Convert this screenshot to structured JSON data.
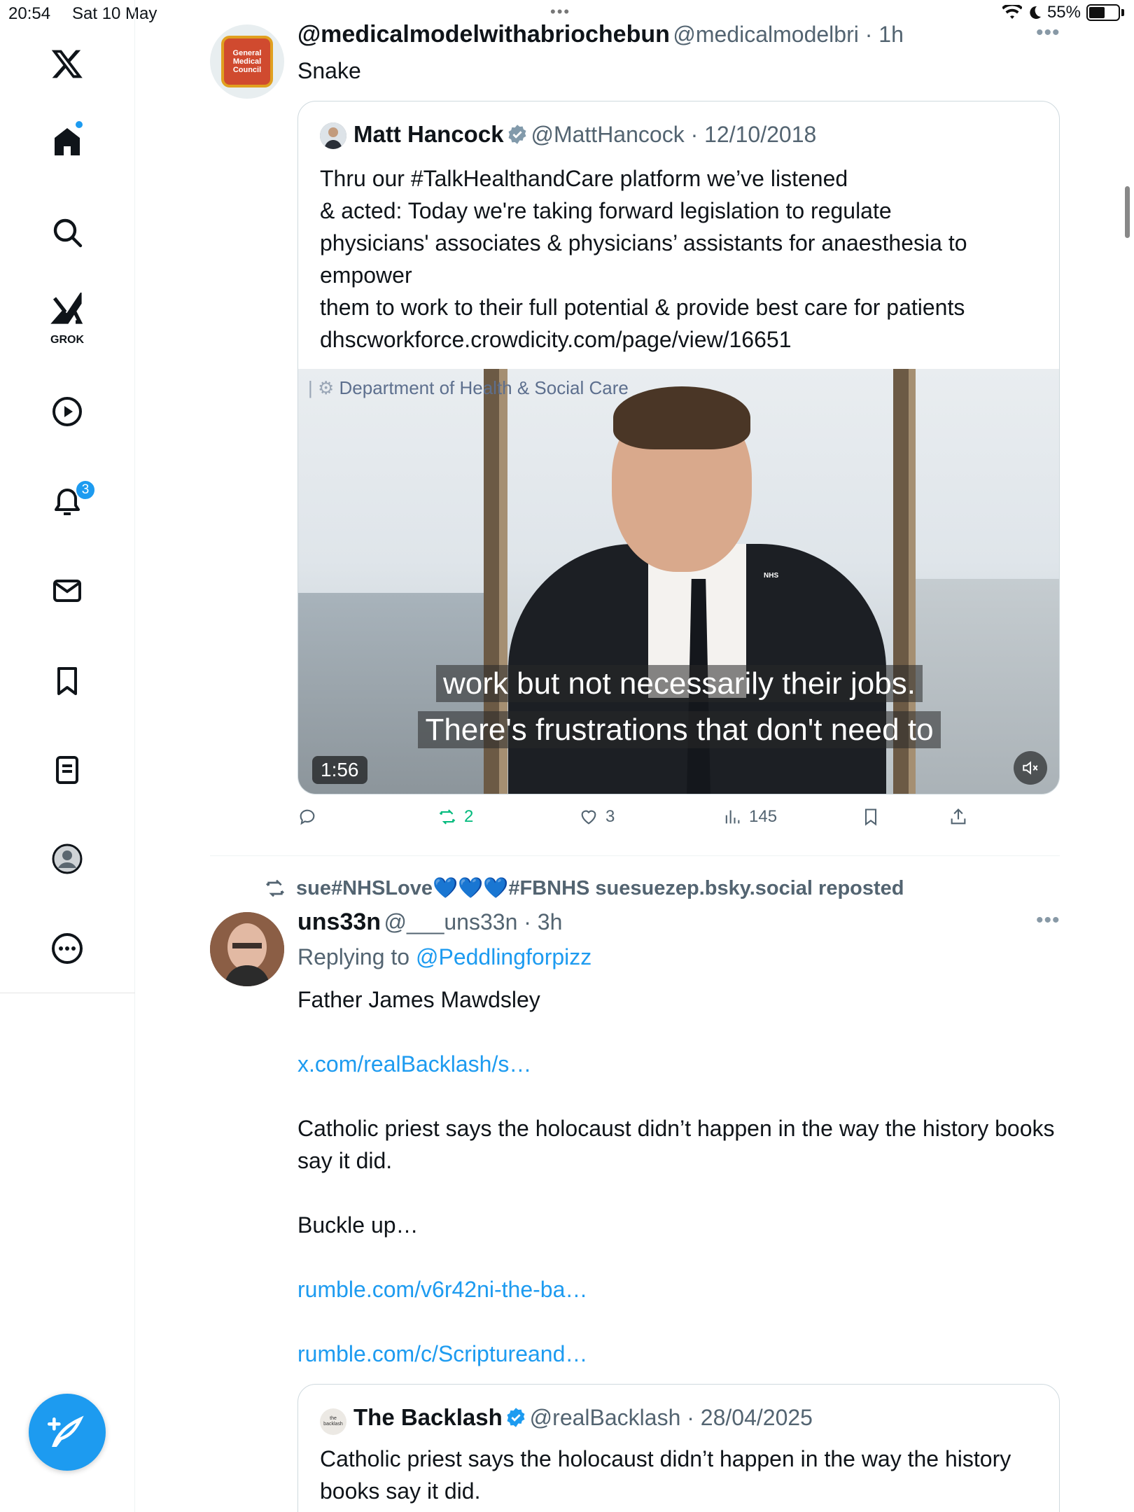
{
  "status_bar": {
    "time": "20:54",
    "date": "Sat 10 May",
    "battery_pct": "55%",
    "battery_level": 0.55,
    "top_dots": "•••"
  },
  "sidebar": {
    "logo": "x-logo-icon",
    "items": [
      {
        "name": "home-icon"
      },
      {
        "name": "search-icon"
      },
      {
        "name": "grok-icon",
        "label": "GROK"
      },
      {
        "name": "video-icon"
      },
      {
        "name": "notifications-icon",
        "badge": "3"
      },
      {
        "name": "messages-icon"
      },
      {
        "name": "bookmarks-icon"
      },
      {
        "name": "lists-icon"
      },
      {
        "name": "profile-icon"
      },
      {
        "name": "more-icon"
      }
    ],
    "compose": "compose-post-icon"
  },
  "tweet1": {
    "display_name": "@medicalmodelwithabriochebun",
    "handle_time": "@medicalmodelbri · 1h",
    "text": "Snake",
    "avatar_text": "General Medical Council",
    "quote": {
      "display_name": "Matt Hancock",
      "handle_time": "@MattHancock · 12/10/2018",
      "lines": [
        "Thru our #TalkHealthandCare platform we’ve listened",
        "& acted: Today we're taking forward legislation to regulate",
        "physicians' associates & physicians’ assistants for anaesthesia to",
        "empower",
        "them to work to their full potential & provide best care for patients",
        "dhscworkforce.crowdicity.com/page/view/16651"
      ],
      "video": {
        "watermark": "Department of Health & Social Care",
        "caption_line1": "work but not necessarily their jobs.",
        "caption_line2": "There's frustrations that don't need to",
        "duration": "1:56",
        "badge": "NHS"
      }
    },
    "actions": {
      "replies": "",
      "reposts": "2",
      "likes": "3",
      "views": "145"
    }
  },
  "tweet2": {
    "repost_by": "sue#NHSLove💙💙💙#FBNHS suesuezep.bsky.social reposted",
    "display_name": "uns33n",
    "handle_time": "@___uns33n · 3h",
    "replying_prefix": "Replying to ",
    "replying_to": "@Peddlingforpizz",
    "p1": "Father James Mawdsley",
    "p2": "x.com/realBacklash/s…",
    "p3": "Catholic priest says the holocaust didn’t happen in the way the history books say it did.",
    "p4": "Buckle up…",
    "p5": "rumble.com/v6r42ni-the-ba…",
    "p6": "rumble.com/c/Scriptureand…",
    "quote": {
      "display_name": "The Backlash",
      "handle_time": "@realBacklash · 28/04/2025",
      "text": "Catholic priest says the holocaust didn’t happen in the way the history books say it did.",
      "avatar_text": "the backlash"
    }
  },
  "colors": {
    "accent": "#1d9bf0",
    "repost_green": "#00ba7c",
    "muted": "#536471"
  }
}
